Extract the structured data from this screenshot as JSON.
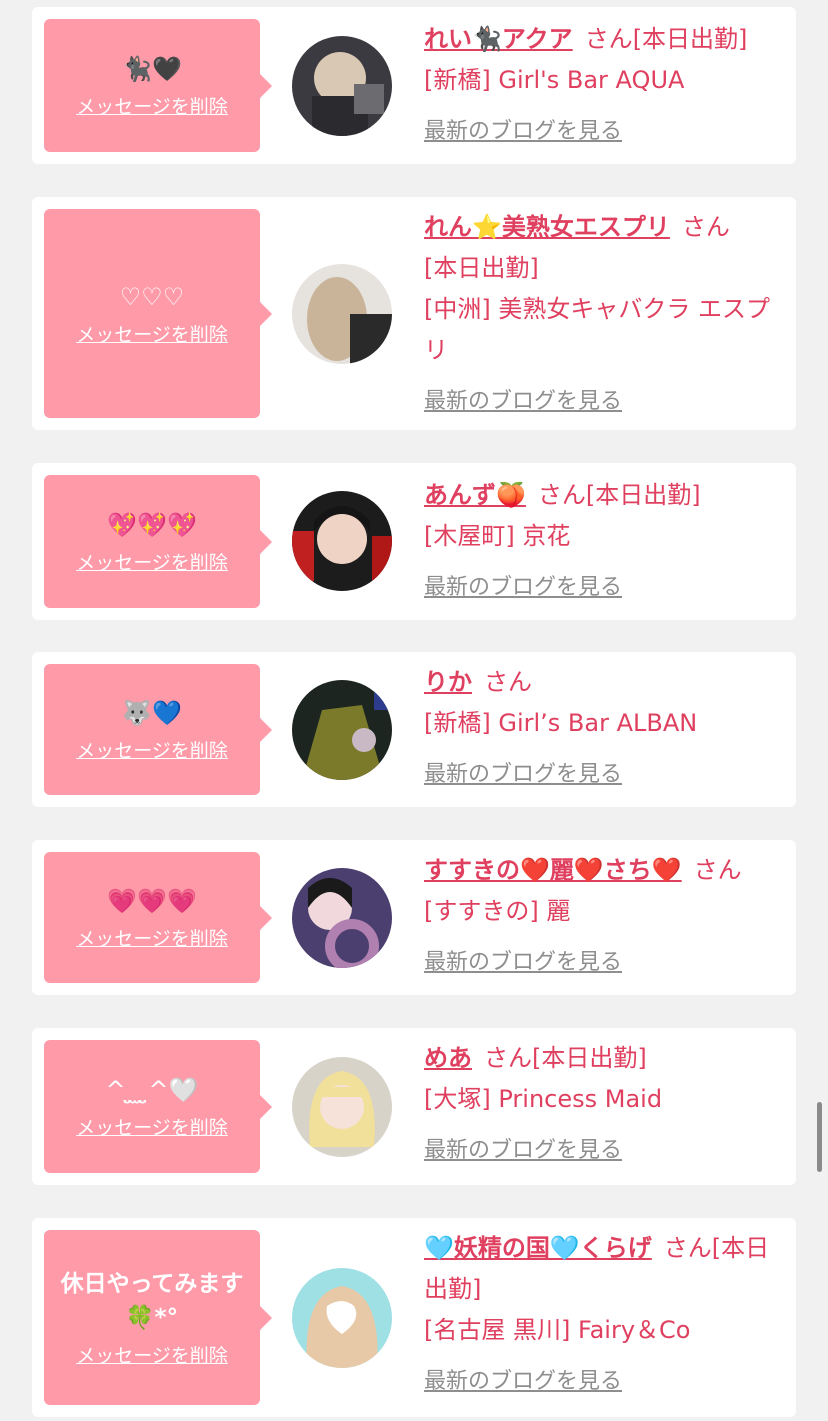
{
  "delete_label": "メッセージを削除",
  "blog_label": "最新のブログを見る",
  "san_label": "さん",
  "cards": [
    {
      "message": "🐈‍⬛🖤",
      "name": "れい🐈‍⬛アクア",
      "status": "[本日出勤]",
      "shop": "[新橋] Girl's Bar AQUA",
      "avatar_icon": "avatar-icon"
    },
    {
      "message": "♡♡♡",
      "name": "れん⭐美熟女エスプリ",
      "status": "[本日出勤]",
      "shop": "[中洲] 美熟女キャバクラ エスプリ",
      "avatar_icon": "avatar-icon"
    },
    {
      "message": "💖💖💖",
      "name": "あんず🍑",
      "status": "[本日出勤]",
      "shop": "[木屋町] 京花",
      "avatar_icon": "avatar-icon"
    },
    {
      "message": "🐺💙",
      "name": "りか",
      "status": "",
      "shop": "[新橋] Girl’s Bar ALBAN",
      "avatar_icon": "avatar-icon"
    },
    {
      "message": "💗💗💗",
      "name": "すすきの❤️麗❤️さち❤️",
      "status": "",
      "shop": "[すすきの] 麗",
      "avatar_icon": "avatar-icon"
    },
    {
      "message": "^ ̤̮ ̫ ̤̮^🤍",
      "name": "めあ",
      "status": "[本日出勤]",
      "shop": "[大塚] Princess Maid",
      "avatar_icon": "avatar-icon"
    },
    {
      "message": "休日やってみます🍀*°",
      "name": "🩵妖精の国🩵くらげ",
      "status": "[本日出勤]",
      "shop": "[名古屋 黒川] Fairy＆Co",
      "avatar_icon": "avatar-icon"
    }
  ],
  "colors": {
    "bubble": "#ff9aa9",
    "name": "#e0405f",
    "blog_link": "#8e8e8e",
    "background": "#f1f1f1"
  }
}
